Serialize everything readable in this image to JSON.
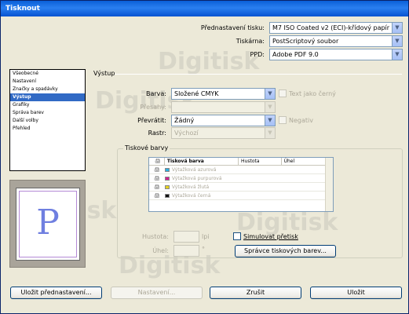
{
  "window": {
    "title": "Tisknout"
  },
  "top": {
    "preset_label": "Přednastavení tisku:",
    "preset_value": "M7 ISO Coated v2 (ECI)-křídový papír",
    "printer_label": "Tiskárna:",
    "printer_value": "PostScriptový soubor",
    "ppd_label": "PPD:",
    "ppd_value": "Adobe PDF 9.0"
  },
  "sidebar": {
    "items": [
      {
        "label": "Všeobecné"
      },
      {
        "label": "Nastavení"
      },
      {
        "label": "Značky a spadávky"
      },
      {
        "label": "Výstup",
        "active": true
      },
      {
        "label": "Grafiky"
      },
      {
        "label": "Správa barev"
      },
      {
        "label": "Další volby"
      },
      {
        "label": "Přehled"
      }
    ]
  },
  "preview": {
    "letter": "P"
  },
  "output": {
    "section_title": "Výstup",
    "color_label": "Barva:",
    "color_value": "Složené CMYK",
    "text_black_label": "Text jako černý",
    "trapping_label": "Přesahy:",
    "trapping_value": "",
    "flip_label": "Převrátit:",
    "flip_value": "Žádný",
    "negative_label": "Negativ",
    "screen_label": "Rastr:",
    "screen_value": "Výchozí"
  },
  "inks": {
    "group_title": "Tiskové barvy",
    "columns": [
      "",
      "Tisková barva",
      "Hustota",
      "Úhel"
    ],
    "rows": [
      {
        "name": "Výtažková azurová",
        "color": "#2ab0e0"
      },
      {
        "name": "Výtažková purpurová",
        "color": "#d02090"
      },
      {
        "name": "Výtažková žlutá",
        "color": "#e6d21e"
      },
      {
        "name": "Výtažková černá",
        "color": "#111111"
      }
    ],
    "density_label": "Hustota:",
    "density_unit": "lpi",
    "angle_label": "Úhel:",
    "angle_unit": "°",
    "simulate_overprint_label": "Simulovat přetisk",
    "ink_manager_button": "Správce tiskových barev..."
  },
  "footer": {
    "save_preset": "Uložit přednastavení...",
    "setup": "Nastavení...",
    "cancel": "Zrušit",
    "save": "Uložit"
  },
  "watermark": {
    "text": "Digitisk"
  }
}
